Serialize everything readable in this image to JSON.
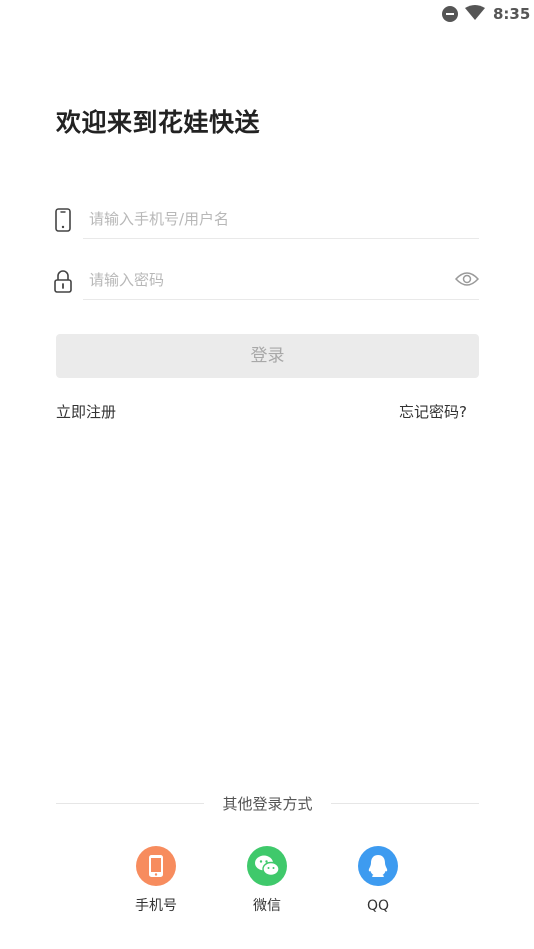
{
  "status_bar": {
    "time": "8:35",
    "icons": [
      "do-not-disturb-icon",
      "wifi-icon"
    ]
  },
  "title": "欢迎来到花娃快送",
  "form": {
    "account": {
      "placeholder": "请输入手机号/用户名",
      "value": "",
      "icon": "phone-icon"
    },
    "password": {
      "placeholder": "请输入密码",
      "value": "",
      "icon": "lock-icon",
      "toggle_icon": "eye-icon"
    },
    "login_label": "登录",
    "register_label": "立即注册",
    "forgot_label": "忘记密码?"
  },
  "other_login": {
    "title": "其他登录方式",
    "options": [
      {
        "label": "手机号",
        "icon": "phone-icon",
        "color": "#f78c5e"
      },
      {
        "label": "微信",
        "icon": "wechat-icon",
        "color": "#3fc96b"
      },
      {
        "label": "QQ",
        "icon": "qq-icon",
        "color": "#3d9bf0"
      }
    ]
  },
  "colors": {
    "button_disabled_bg": "#ebebeb",
    "button_disabled_text": "#a8a8a8",
    "divider": "#e9e9e9"
  }
}
